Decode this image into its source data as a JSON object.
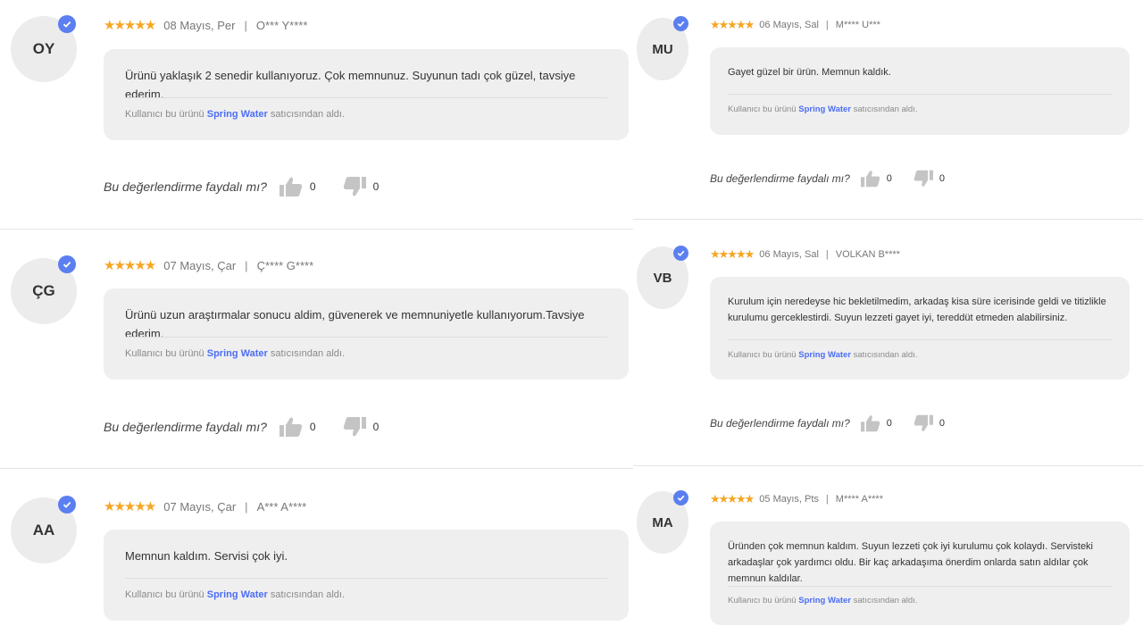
{
  "helpful_question": "Bu değerlendirme faydalı mı?",
  "seller_prefix": "Kullanıcı bu ürünü",
  "seller_name": "Spring Water",
  "seller_suffix": "satıcısından aldı.",
  "stars_glyph": "★★★★★",
  "separator": "|",
  "colors": {
    "star": "#f5a623",
    "badge": "#5b7ff0",
    "store_link": "#4c6ef5",
    "bubble": "#efefef"
  },
  "reviews": [
    {
      "initials": "OY",
      "rating": 5,
      "date": "08 Mayıs, Per",
      "author": "O*** Y****",
      "text": "Ürünü yaklaşık 2 senedir kullanıyoruz. Çok memnunuz. Suyunun tadı çok güzel, tavsiye ederim.",
      "likes": "0",
      "dislikes": "0"
    },
    {
      "initials": "ÇG",
      "rating": 5,
      "date": "07 Mayıs, Çar",
      "author": "Ç**** G****",
      "text": "Ürünü uzun araştırmalar sonucu aldim, güvenerek ve memnuniyetle kullanıyorum.Tavsiye ederim.",
      "likes": "0",
      "dislikes": "0"
    },
    {
      "initials": "AA",
      "rating": 5,
      "date": "07 Mayıs, Çar",
      "author": "A*** A****",
      "text": "Memnun kaldım. Servisi çok iyi.",
      "likes": "",
      "dislikes": ""
    },
    {
      "initials": "MU",
      "rating": 5,
      "date": "06 Mayıs, Sal",
      "author": "M**** U***",
      "text": "Gayet güzel bir ürün. Memnun kaldık.",
      "likes": "0",
      "dislikes": "0"
    },
    {
      "initials": "VB",
      "rating": 5,
      "date": "06 Mayıs, Sal",
      "author": "VOLKAN B****",
      "text": "Kurulum için neredeyse hic bekletilmedim, arkadaş kisa süre icerisinde geldi ve titizlikle kurulumu gerceklestirdi. Suyun lezzeti gayet iyi, tereddüt etmeden alabilirsiniz.",
      "likes": "0",
      "dislikes": "0"
    },
    {
      "initials": "MA",
      "rating": 5,
      "date": "05 Mayıs, Pts",
      "author": "M**** A****",
      "text": "Üründen çok memnun kaldım. Suyun lezzeti çok iyi kurulumu çok kolaydı. Servisteki arkadaşlar çok yardımcı oldu. Bir kaç arkadaşıma önerdim onlarda satın aldılar çok memnun kaldılar.",
      "likes": "",
      "dislikes": ""
    }
  ]
}
